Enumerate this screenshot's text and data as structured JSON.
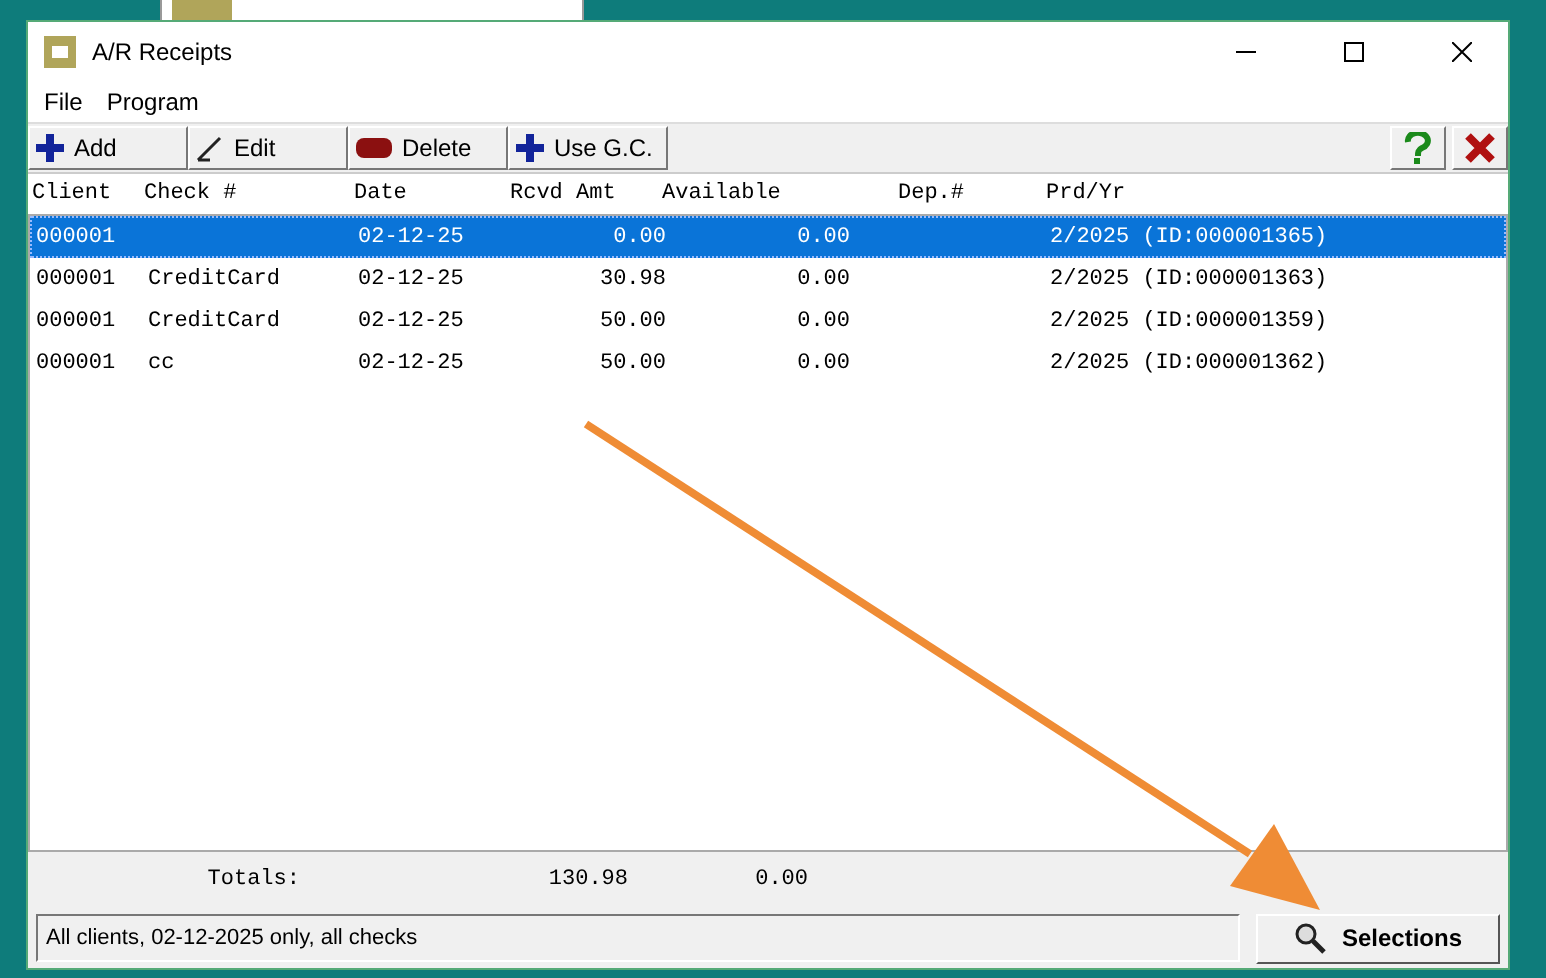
{
  "window": {
    "title": "A/R Receipts"
  },
  "menu": [
    "File",
    "Program"
  ],
  "toolbar": [
    {
      "label": "Add",
      "kind": "add"
    },
    {
      "label": "Edit",
      "kind": "edit"
    },
    {
      "label": "Delete",
      "kind": "delete"
    },
    {
      "label": "Use G.C.",
      "kind": "add"
    }
  ],
  "table": {
    "columns": [
      "Client",
      "Check #",
      "Date",
      "Rcvd Amt",
      "Available",
      "Dep.#",
      "Prd/Yr"
    ],
    "rows": [
      {
        "selected": true,
        "cells": [
          "000001",
          "",
          "02-12-25",
          "0.00",
          "0.00",
          "",
          "2/2025 (ID:000001365)"
        ]
      },
      {
        "selected": false,
        "cells": [
          "000001",
          "CreditCard",
          "02-12-25",
          "30.98",
          "0.00",
          "",
          "2/2025 (ID:000001363)"
        ]
      },
      {
        "selected": false,
        "cells": [
          "000001",
          "CreditCard",
          "02-12-25",
          "50.00",
          "0.00",
          "",
          "2/2025 (ID:000001359)"
        ]
      },
      {
        "selected": false,
        "cells": [
          "000001",
          "cc",
          "02-12-25",
          "50.00",
          "0.00",
          "",
          "2/2025 (ID:000001362)"
        ]
      }
    ]
  },
  "totals": {
    "label": "Totals:",
    "rcvd": "130.98",
    "available": "0.00"
  },
  "status": "All clients, 02-12-2025 only, all checks",
  "selections_button": "Selections"
}
